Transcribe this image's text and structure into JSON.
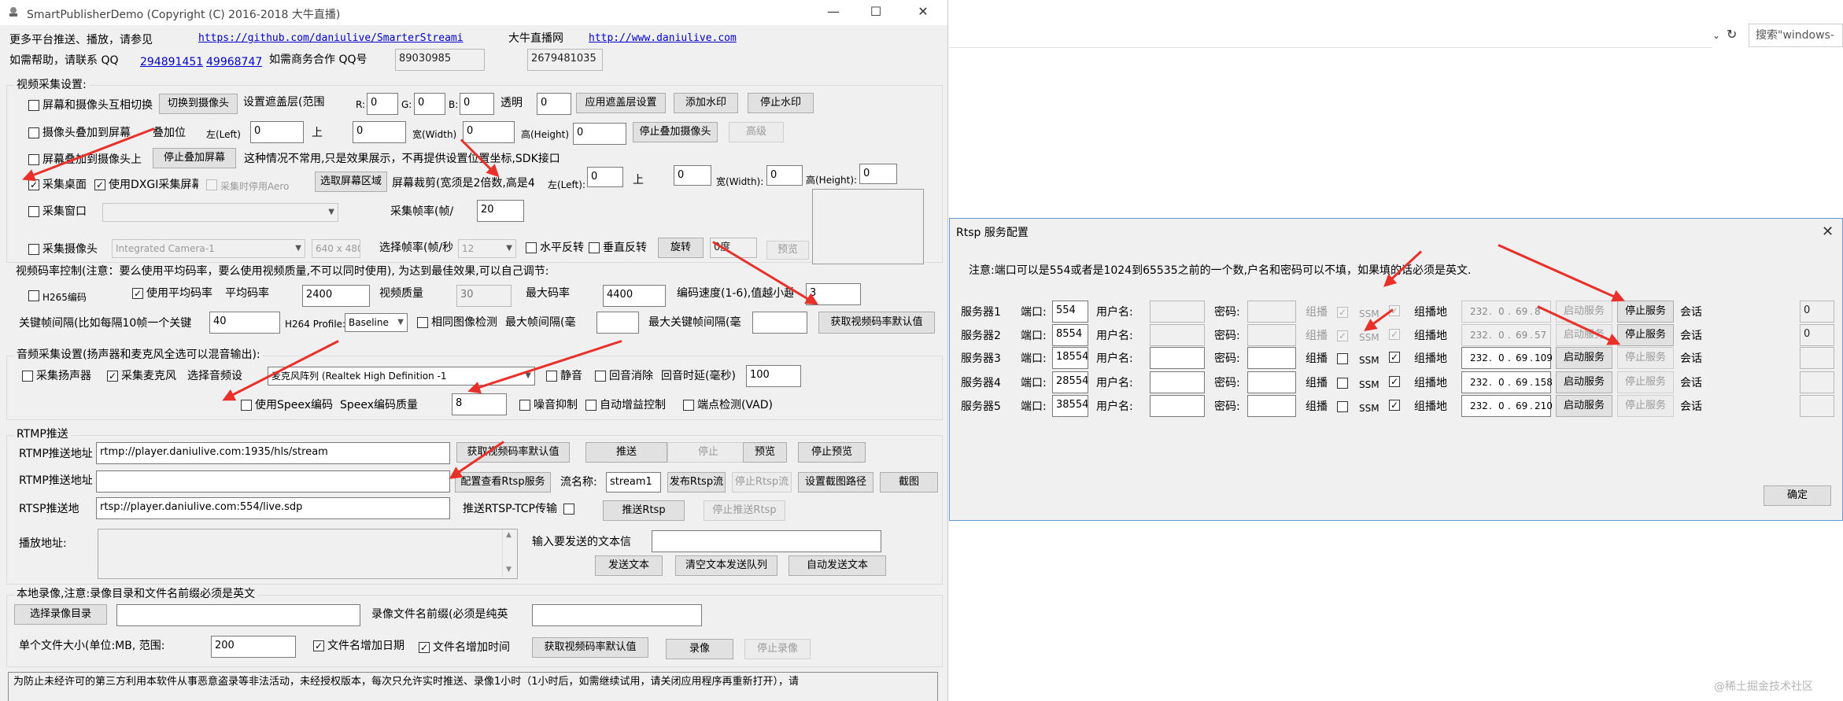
{
  "app": {
    "title": "SmartPublisherDemo  (Copyright (C) 2016-2018 大牛直播)",
    "minimize": "—",
    "maximize": "☐",
    "close": "✕"
  },
  "header": {
    "more_platforms": "更多平台推送、播放，请参见",
    "github_url": "https://github.com/daniulive/SmarterStreami",
    "site_name": "大牛直播网",
    "site_url": "http://www.daniulive.com",
    "help_label": "如需帮助，请联系 QQ",
    "qq1": "294891451",
    "qq2": "49968747",
    "biz_label": "如需商务合作 QQ号",
    "biz_qq1": "89030985",
    "biz_qq2": "2679481035"
  },
  "video": {
    "group_title": "视频采集设置:",
    "screen_cam_switch": "屏幕和摄像头互相切换",
    "switch_to_cam": "切换到摄像头",
    "set_mask_range": "设置遮盖层(范围",
    "r_label": "R:",
    "r_value": "0",
    "g_label": "G:",
    "g_value": "0",
    "b_label": "B:",
    "b_value": "0",
    "alpha_label": "透明",
    "alpha_value": "0",
    "apply_mask": "应用遮盖层设置",
    "add_watermark": "添加水印",
    "stop_watermark": "停止水印",
    "cam_overlay_screen": "摄像头叠加到屏幕",
    "overlay_pos": "叠加位",
    "left_label": "左(Left)",
    "left_value": "0",
    "top_label": "上",
    "top_value": "0",
    "width_label": "宽(Width)",
    "width_value": "0",
    "height_label": "高(Height)",
    "height_value": "0",
    "stop_overlay_cam": "停止叠加摄像头",
    "advanced": "高级",
    "screen_overlay_cam": "屏幕叠加到摄像头上",
    "stop_overlay_screen": "停止叠加屏幕",
    "overlay_note": "这种情况不常用,只是效果展示，不再提供设置位置坐标,SDK接口",
    "capture_desktop": "采集桌面",
    "use_dxgi": "使用DXGI采集屏幕",
    "disable_aero": "采集时停用Aero",
    "select_region": "选取屏幕区域",
    "crop_label": "屏幕裁剪(宽须是2倍数,高是4",
    "crop_left_label": "左(Left):",
    "crop_left": "0",
    "crop_top_label": "上",
    "crop_top": "0",
    "crop_width_label": "宽(Width):",
    "crop_width": "0",
    "crop_height_label": "高(Height):",
    "crop_height": "0",
    "capture_window": "采集窗口",
    "fps_label": "采集帧率(帧/",
    "fps_value": "20",
    "capture_camera": "采集摄像头",
    "camera_name": "Integrated Camera-1",
    "resolution": "640 x 480",
    "select_fps_label": "选择帧率(帧/秒",
    "select_fps_value": "12",
    "h_flip": "水平反转",
    "v_flip": "垂直反转",
    "rotate": "旋转",
    "rotate_value": "0度",
    "preview": "预览"
  },
  "bitrate": {
    "title": "视频码率控制(注意：要么使用平均码率，要么使用视频质量,不可以同时使用), 为达到最佳效果,可以自己调节:",
    "h265": "H265编码",
    "use_avg": "使用平均码率",
    "avg_label": "平均码率",
    "avg_value": "2400",
    "quality_label": "视频质量",
    "quality_value": "30",
    "max_rate_label": "最大码率",
    "max_rate_value": "4400",
    "speed_label": "编码速度(1-6),值越小越",
    "speed_value": "3",
    "keyframe_label": "关键帧间隔(比如每隔10帧一个关键",
    "keyframe_value": "40",
    "profile_label": "H264 Profile:",
    "profile_value": "Baseline",
    "same_image": "相同图像检测",
    "max_interval_label": "最大帧间隔(毫",
    "max_key_label": "最大关键帧间隔(毫",
    "get_default": "获取视频码率默认值"
  },
  "audio": {
    "title": "音频采集设置(扬声器和麦克风全选可以混音输出):",
    "speaker": "采集扬声器",
    "mic": "采集麦克风",
    "select_audio": "选择音频设",
    "mic_device": "麦克风阵列 (Realtek High Definition -1",
    "mute": "静音",
    "echo_cancel": "回音消除",
    "echo_delay_label": "回音时延(毫秒)",
    "echo_delay": "100",
    "use_speex": "使用Speex编码",
    "speex_quality_label": "Speex编码质量",
    "speex_quality": "8",
    "noise": "噪音抑制",
    "agc": "自动增益控制",
    "vad": "端点检测(VAD)"
  },
  "rtmp": {
    "title": "RTMP推送",
    "push_url_label": "RTMP推送地址",
    "push_url": "rtmp://player.daniulive.com:1935/hls/stream",
    "get_default": "获取视频码率默认值",
    "push": "推送",
    "stop": "停止",
    "preview": "预览",
    "stop_preview": "停止预览",
    "push_url2_label": "RTMP推送地址",
    "push_url2": "",
    "config_rtsp": "配置查看Rtsp服务",
    "stream_name_label": "流名称:",
    "stream_name": "stream1",
    "publish_rtsp": "发布Rtsp流",
    "stop_rtsp_stream": "停止Rtsp流",
    "set_snapshot_path": "设置截图路径",
    "snapshot": "截图",
    "rtsp_url_label": "RTSP推送地",
    "rtsp_url": "rtsp://player.daniulive.com:554/live.sdp",
    "rtsp_tcp": "推送RTSP-TCP传输",
    "push_rtsp": "推送Rtsp",
    "stop_push_rtsp": "停止推送Rtsp",
    "play_url_label": "播放地址:",
    "input_text_label": "输入要发送的文本信",
    "send_text": "发送文本",
    "clear_queue": "清空文本发送队列",
    "auto_send": "自动发送文本"
  },
  "record": {
    "title": "本地录像,注意:录像目录和文件名前缀必须是英文",
    "choose_dir": "选择录像目录",
    "prefix_label": "录像文件名前缀(必须是纯英",
    "file_size_label": "单个文件大小(单位:MB, 范围:",
    "file_size": "200",
    "add_date": "文件名增加日期",
    "add_time": "文件名增加时间",
    "get_default": "获取视频码率默认值",
    "record": "录像",
    "stop_record": "停止录像"
  },
  "notice": "为防止未经许可的第三方利用本软件从事恶意盗录等非法活动，未经授权版本，每次只允许实时推送、录像1小时（1小时后，如需继续试用，请关闭应用程序再重新打开），请",
  "browser": {
    "search_placeholder": "搜索\"windows-"
  },
  "dialog": {
    "title": "Rtsp 服务配置",
    "note": "注意:端口可以是554或者是1024到65535之前的一个数,户名和密码可以不填，如果填的话必须是英文.",
    "port_label": "端口:",
    "user_label": "用户名:",
    "pwd_label": "密码:",
    "multicast_label": "组播",
    "ssm_label": "SSM",
    "mcast_addr_label": "组播地",
    "session_label": "会话",
    "start_label": "启动服务",
    "stop_label": "停止服务",
    "ok": "确定",
    "servers": [
      {
        "name": "服务器1",
        "port": "554",
        "ip": [
          "232",
          "0",
          "69",
          "8"
        ],
        "session": "0",
        "running": true
      },
      {
        "name": "服务器2",
        "port": "8554",
        "ip": [
          "232",
          "0",
          "69",
          "57"
        ],
        "session": "0",
        "running": true
      },
      {
        "name": "服务器3",
        "port": "18554",
        "ip": [
          "232",
          "0",
          "69",
          "109"
        ],
        "session": "",
        "running": false
      },
      {
        "name": "服务器4",
        "port": "28554",
        "ip": [
          "232",
          "0",
          "69",
          "158"
        ],
        "session": "",
        "running": false
      },
      {
        "name": "服务器5",
        "port": "38554",
        "ip": [
          "232",
          "0",
          "69",
          "210"
        ],
        "session": "",
        "running": false
      }
    ]
  },
  "watermark": "@稀土掘金技术社区",
  "colors": {
    "annotation_arrow": "#e8312a",
    "link": "#0000cc",
    "dialog_border": "#6a9bd8"
  }
}
